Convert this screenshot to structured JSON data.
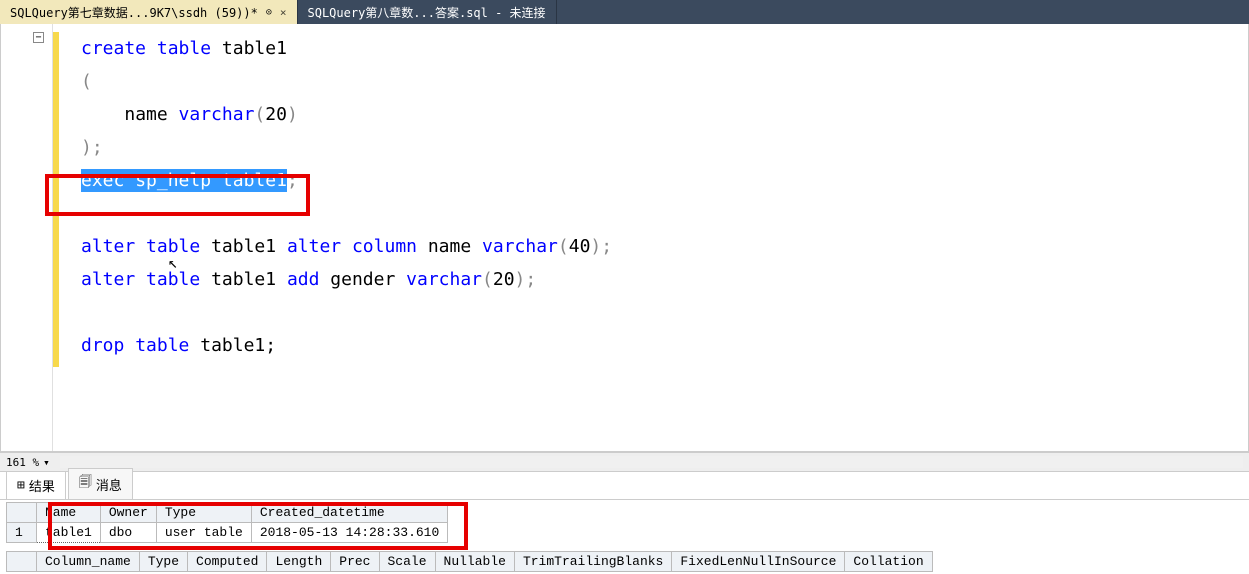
{
  "tabs": [
    {
      "label": "SQLQuery第七章数据...9K7\\ssdh (59))*",
      "active": true
    },
    {
      "label": "SQLQuery第八章数...答案.sql - 未连接",
      "active": false
    }
  ],
  "code": {
    "l1": {
      "create": "create",
      "table": "table",
      "name": "table1"
    },
    "l2": "(",
    "l3": {
      "indent": "    ",
      "col": "name ",
      "type": "varchar",
      "open": "(",
      "num": "20",
      "close": ")"
    },
    "l4": ");",
    "l5": {
      "exec": "exec",
      "sp": "sp_help",
      "tbl": "table1"
    },
    "l6": {
      "alter": "alter",
      "table": "table",
      "tbl": "table1",
      "alter2": "alter",
      "column": "column",
      "col": "name ",
      "type": "varchar",
      "open": "(",
      "num": "40",
      "close": ");"
    },
    "l7": {
      "alter": "alter",
      "table": "table",
      "tbl": "table1",
      "add": "add",
      "col": "gender ",
      "type": "varchar",
      "open": "(",
      "num": "20",
      "close": ");"
    },
    "l8": {
      "drop": "drop",
      "table": "table",
      "tbl": "table1;"
    }
  },
  "zoom": {
    "value": "161 %"
  },
  "results_tabs": {
    "results": "结果",
    "messages": "消息"
  },
  "grid1": {
    "headers": [
      "Name",
      "Owner",
      "Type",
      "Created_datetime"
    ],
    "row_num": "1",
    "row": [
      "table1",
      "dbo",
      "user table",
      "2018-05-13 14:28:33.610"
    ]
  },
  "grid2": {
    "headers": [
      "Column_name",
      "Type",
      "Computed",
      "Length",
      "Prec",
      "Scale",
      "Nullable",
      "TrimTrailingBlanks",
      "FixedLenNullInSource",
      "Collation"
    ]
  },
  "icons": {
    "grid": "⊞",
    "msg": "🗐",
    "collapse": "−",
    "pin": "⊙",
    "close": "×",
    "dropdown": "▾",
    "cursor": "↖"
  }
}
